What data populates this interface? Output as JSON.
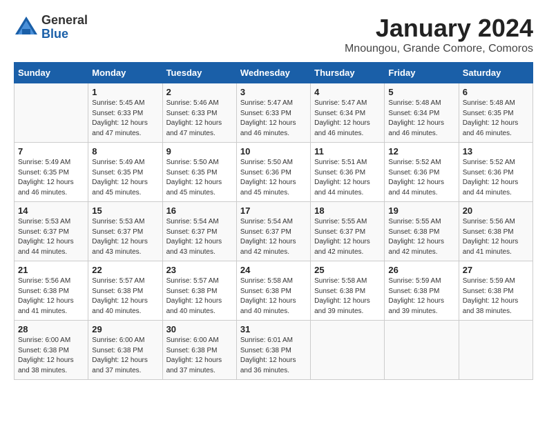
{
  "header": {
    "logo_general": "General",
    "logo_blue": "Blue",
    "month_title": "January 2024",
    "location": "Mnoungou, Grande Comore, Comoros"
  },
  "days_of_week": [
    "Sunday",
    "Monday",
    "Tuesday",
    "Wednesday",
    "Thursday",
    "Friday",
    "Saturday"
  ],
  "weeks": [
    [
      {
        "day": "",
        "sunrise": "",
        "sunset": "",
        "daylight": ""
      },
      {
        "day": "1",
        "sunrise": "Sunrise: 5:45 AM",
        "sunset": "Sunset: 6:33 PM",
        "daylight": "Daylight: 12 hours and 47 minutes."
      },
      {
        "day": "2",
        "sunrise": "Sunrise: 5:46 AM",
        "sunset": "Sunset: 6:33 PM",
        "daylight": "Daylight: 12 hours and 47 minutes."
      },
      {
        "day": "3",
        "sunrise": "Sunrise: 5:47 AM",
        "sunset": "Sunset: 6:33 PM",
        "daylight": "Daylight: 12 hours and 46 minutes."
      },
      {
        "day": "4",
        "sunrise": "Sunrise: 5:47 AM",
        "sunset": "Sunset: 6:34 PM",
        "daylight": "Daylight: 12 hours and 46 minutes."
      },
      {
        "day": "5",
        "sunrise": "Sunrise: 5:48 AM",
        "sunset": "Sunset: 6:34 PM",
        "daylight": "Daylight: 12 hours and 46 minutes."
      },
      {
        "day": "6",
        "sunrise": "Sunrise: 5:48 AM",
        "sunset": "Sunset: 6:35 PM",
        "daylight": "Daylight: 12 hours and 46 minutes."
      }
    ],
    [
      {
        "day": "7",
        "sunrise": "Sunrise: 5:49 AM",
        "sunset": "Sunset: 6:35 PM",
        "daylight": "Daylight: 12 hours and 46 minutes."
      },
      {
        "day": "8",
        "sunrise": "Sunrise: 5:49 AM",
        "sunset": "Sunset: 6:35 PM",
        "daylight": "Daylight: 12 hours and 45 minutes."
      },
      {
        "day": "9",
        "sunrise": "Sunrise: 5:50 AM",
        "sunset": "Sunset: 6:35 PM",
        "daylight": "Daylight: 12 hours and 45 minutes."
      },
      {
        "day": "10",
        "sunrise": "Sunrise: 5:50 AM",
        "sunset": "Sunset: 6:36 PM",
        "daylight": "Daylight: 12 hours and 45 minutes."
      },
      {
        "day": "11",
        "sunrise": "Sunrise: 5:51 AM",
        "sunset": "Sunset: 6:36 PM",
        "daylight": "Daylight: 12 hours and 44 minutes."
      },
      {
        "day": "12",
        "sunrise": "Sunrise: 5:52 AM",
        "sunset": "Sunset: 6:36 PM",
        "daylight": "Daylight: 12 hours and 44 minutes."
      },
      {
        "day": "13",
        "sunrise": "Sunrise: 5:52 AM",
        "sunset": "Sunset: 6:36 PM",
        "daylight": "Daylight: 12 hours and 44 minutes."
      }
    ],
    [
      {
        "day": "14",
        "sunrise": "Sunrise: 5:53 AM",
        "sunset": "Sunset: 6:37 PM",
        "daylight": "Daylight: 12 hours and 44 minutes."
      },
      {
        "day": "15",
        "sunrise": "Sunrise: 5:53 AM",
        "sunset": "Sunset: 6:37 PM",
        "daylight": "Daylight: 12 hours and 43 minutes."
      },
      {
        "day": "16",
        "sunrise": "Sunrise: 5:54 AM",
        "sunset": "Sunset: 6:37 PM",
        "daylight": "Daylight: 12 hours and 43 minutes."
      },
      {
        "day": "17",
        "sunrise": "Sunrise: 5:54 AM",
        "sunset": "Sunset: 6:37 PM",
        "daylight": "Daylight: 12 hours and 42 minutes."
      },
      {
        "day": "18",
        "sunrise": "Sunrise: 5:55 AM",
        "sunset": "Sunset: 6:37 PM",
        "daylight": "Daylight: 12 hours and 42 minutes."
      },
      {
        "day": "19",
        "sunrise": "Sunrise: 5:55 AM",
        "sunset": "Sunset: 6:38 PM",
        "daylight": "Daylight: 12 hours and 42 minutes."
      },
      {
        "day": "20",
        "sunrise": "Sunrise: 5:56 AM",
        "sunset": "Sunset: 6:38 PM",
        "daylight": "Daylight: 12 hours and 41 minutes."
      }
    ],
    [
      {
        "day": "21",
        "sunrise": "Sunrise: 5:56 AM",
        "sunset": "Sunset: 6:38 PM",
        "daylight": "Daylight: 12 hours and 41 minutes."
      },
      {
        "day": "22",
        "sunrise": "Sunrise: 5:57 AM",
        "sunset": "Sunset: 6:38 PM",
        "daylight": "Daylight: 12 hours and 40 minutes."
      },
      {
        "day": "23",
        "sunrise": "Sunrise: 5:57 AM",
        "sunset": "Sunset: 6:38 PM",
        "daylight": "Daylight: 12 hours and 40 minutes."
      },
      {
        "day": "24",
        "sunrise": "Sunrise: 5:58 AM",
        "sunset": "Sunset: 6:38 PM",
        "daylight": "Daylight: 12 hours and 40 minutes."
      },
      {
        "day": "25",
        "sunrise": "Sunrise: 5:58 AM",
        "sunset": "Sunset: 6:38 PM",
        "daylight": "Daylight: 12 hours and 39 minutes."
      },
      {
        "day": "26",
        "sunrise": "Sunrise: 5:59 AM",
        "sunset": "Sunset: 6:38 PM",
        "daylight": "Daylight: 12 hours and 39 minutes."
      },
      {
        "day": "27",
        "sunrise": "Sunrise: 5:59 AM",
        "sunset": "Sunset: 6:38 PM",
        "daylight": "Daylight: 12 hours and 38 minutes."
      }
    ],
    [
      {
        "day": "28",
        "sunrise": "Sunrise: 6:00 AM",
        "sunset": "Sunset: 6:38 PM",
        "daylight": "Daylight: 12 hours and 38 minutes."
      },
      {
        "day": "29",
        "sunrise": "Sunrise: 6:00 AM",
        "sunset": "Sunset: 6:38 PM",
        "daylight": "Daylight: 12 hours and 37 minutes."
      },
      {
        "day": "30",
        "sunrise": "Sunrise: 6:00 AM",
        "sunset": "Sunset: 6:38 PM",
        "daylight": "Daylight: 12 hours and 37 minutes."
      },
      {
        "day": "31",
        "sunrise": "Sunrise: 6:01 AM",
        "sunset": "Sunset: 6:38 PM",
        "daylight": "Daylight: 12 hours and 36 minutes."
      },
      {
        "day": "",
        "sunrise": "",
        "sunset": "",
        "daylight": ""
      },
      {
        "day": "",
        "sunrise": "",
        "sunset": "",
        "daylight": ""
      },
      {
        "day": "",
        "sunrise": "",
        "sunset": "",
        "daylight": ""
      }
    ]
  ]
}
